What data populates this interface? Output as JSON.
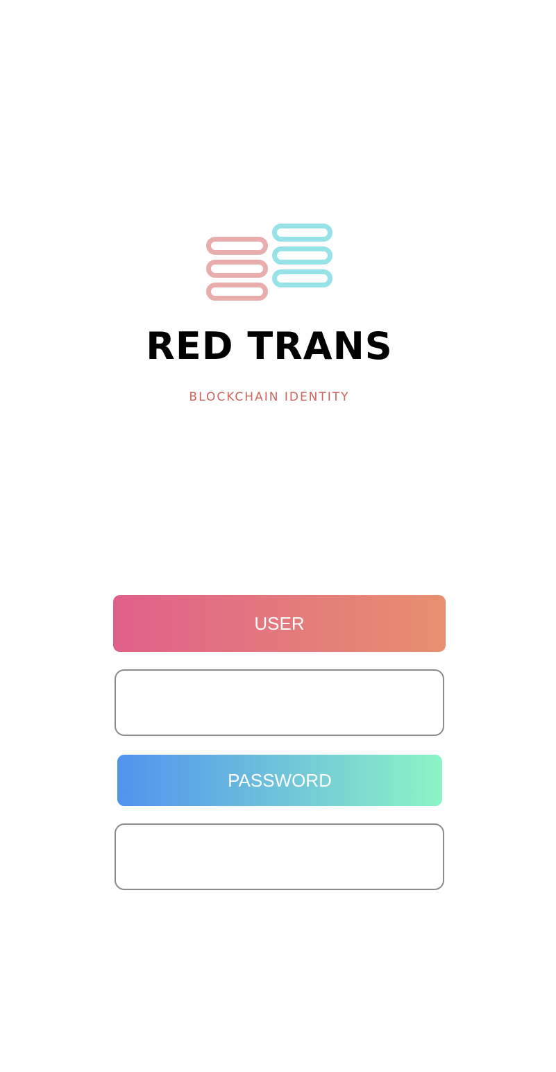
{
  "brand": {
    "title": "RED TRANS",
    "subtitle": "BLOCKCHAIN IDENTITY",
    "logo_icon": "stacked-blocks-icon",
    "colors": {
      "logo_pink": "#eaadad",
      "logo_cyan": "#97e2e6",
      "subtitle": "#d0625c"
    }
  },
  "login": {
    "user_label": "USER",
    "user_value": "",
    "password_label": "PASSWORD",
    "password_value": "",
    "colors": {
      "user_gradient": [
        "#e0608a",
        "#e7906f"
      ],
      "password_gradient": [
        "#5292ee",
        "#8cf4c5"
      ],
      "field_border": "#8a8a8a"
    }
  }
}
